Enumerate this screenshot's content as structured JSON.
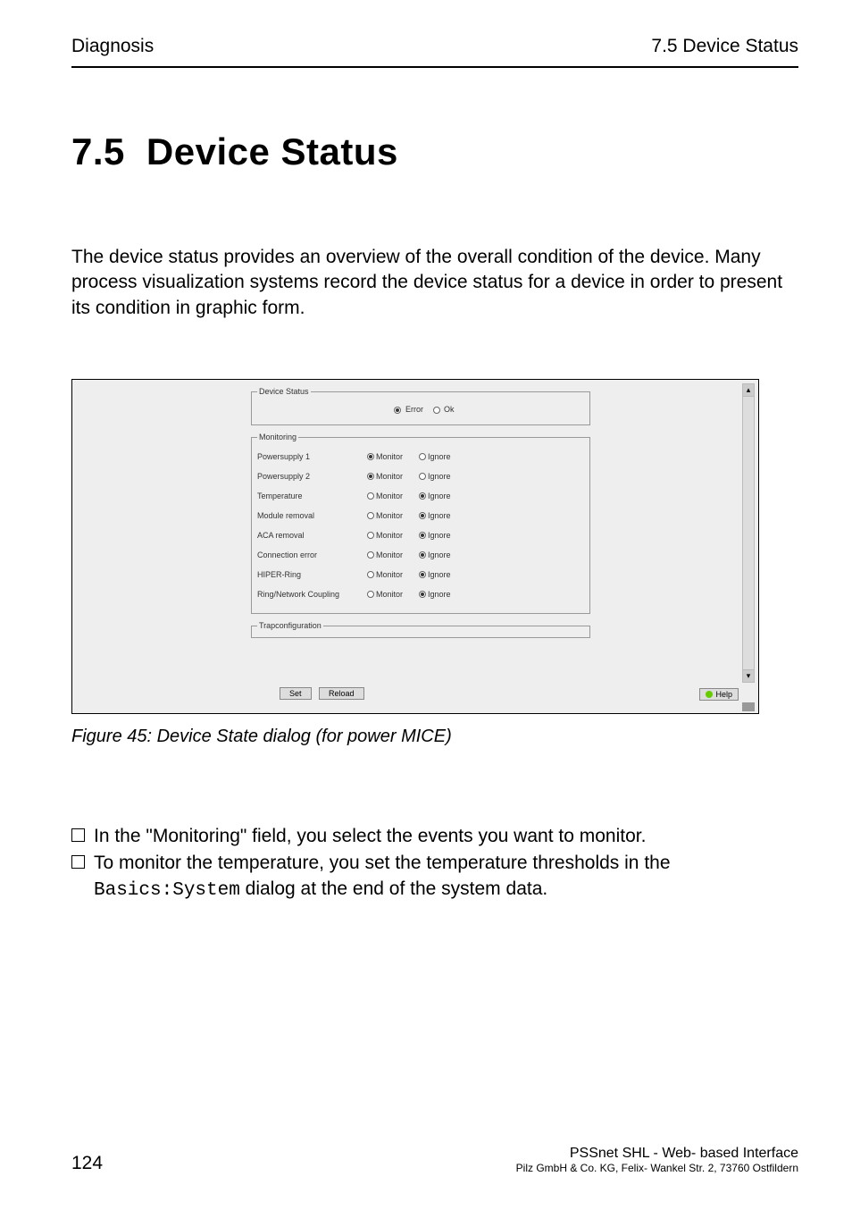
{
  "header": {
    "left": "Diagnosis",
    "right": "7.5  Device Status"
  },
  "heading": {
    "number": "7.5",
    "title": "Device Status"
  },
  "paragraph": "The device status provides an overview of the overall condition of the device. Many process visualization systems record the device status for a device in order to present its condition in graphic form.",
  "dialog": {
    "device_status_legend": "Device Status",
    "error_label": "Error",
    "ok_label": "Ok",
    "monitoring_legend": "Monitoring",
    "items": [
      {
        "label": "Powersupply 1",
        "monitor": true
      },
      {
        "label": "Powersupply 2",
        "monitor": true
      },
      {
        "label": "Temperature",
        "monitor": false
      },
      {
        "label": "Module removal",
        "monitor": false
      },
      {
        "label": "ACA removal",
        "monitor": false
      },
      {
        "label": "Connection error",
        "monitor": false
      },
      {
        "label": "HIPER-Ring",
        "monitor": false
      },
      {
        "label": "Ring/Network Coupling",
        "monitor": false
      }
    ],
    "monitor_col": "Monitor",
    "ignore_col": "Ignore",
    "trap_legend": "Trapconfiguration",
    "set_btn": "Set",
    "reload_btn": "Reload",
    "help_btn": "Help"
  },
  "figure_caption": "Figure 45: Device State dialog (for power MICE)",
  "checklist": {
    "item1": "In the \"Monitoring\" field, you select the events you want to monitor.",
    "item2_a": "To monitor the temperature, you set the temperature thresholds in the ",
    "item2_code": "Basics:System",
    "item2_b": " dialog at the end of the system data."
  },
  "footer": {
    "page": "124",
    "line1": "PSSnet SHL - Web- based Interface",
    "line2": "Pilz GmbH & Co. KG, Felix- Wankel Str. 2, 73760 Ostfildern"
  }
}
